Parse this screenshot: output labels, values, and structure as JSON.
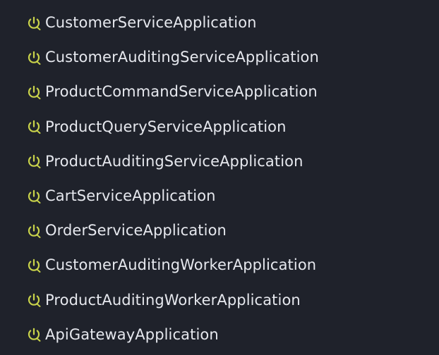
{
  "colors": {
    "background": "#1f222b",
    "icon": "#c9d34a",
    "text": "#e6e8ee"
  },
  "run_configurations": [
    {
      "label": "CustomerServiceApplication",
      "icon": "spring-boot-power-icon"
    },
    {
      "label": "CustomerAuditingServiceApplication",
      "icon": "spring-boot-power-icon"
    },
    {
      "label": "ProductCommandServiceApplication",
      "icon": "spring-boot-power-icon"
    },
    {
      "label": "ProductQueryServiceApplication",
      "icon": "spring-boot-power-icon"
    },
    {
      "label": "ProductAuditingServiceApplication",
      "icon": "spring-boot-power-icon"
    },
    {
      "label": "CartServiceApplication",
      "icon": "spring-boot-power-icon"
    },
    {
      "label": "OrderServiceApplication",
      "icon": "spring-boot-power-icon"
    },
    {
      "label": "CustomerAuditingWorkerApplication",
      "icon": "spring-boot-power-icon"
    },
    {
      "label": "ProductAuditingWorkerApplication",
      "icon": "spring-boot-power-icon"
    },
    {
      "label": "ApiGatewayApplication",
      "icon": "spring-boot-power-icon"
    }
  ]
}
